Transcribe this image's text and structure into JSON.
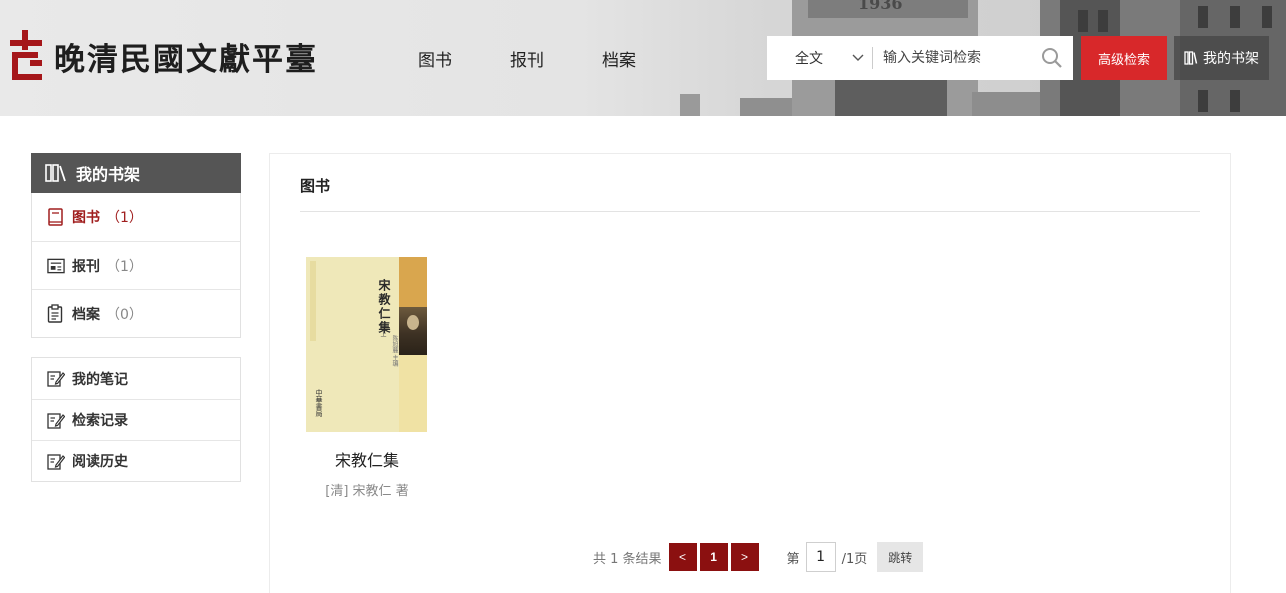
{
  "header": {
    "site_title": "晚清民國文獻平臺",
    "nav": [
      "图书",
      "报刊",
      "档案"
    ],
    "search": {
      "scope": "全文",
      "placeholder": "输入关键词检索"
    },
    "advanced_search": "高级检索",
    "my_shelf": "我的书架",
    "building_sign": "1936"
  },
  "sidebar": {
    "title": "我的书架",
    "categories": [
      {
        "label": "图书",
        "count": "（1）",
        "icon": "book-icon",
        "active": true
      },
      {
        "label": "报刊",
        "count": "（1）",
        "icon": "newspaper-icon",
        "active": false
      },
      {
        "label": "档案",
        "count": "（0）",
        "icon": "clipboard-icon",
        "active": false
      }
    ],
    "tools": [
      {
        "label": "我的笔记",
        "icon": "edit-note-icon"
      },
      {
        "label": "检索记录",
        "icon": "edit-note-icon"
      },
      {
        "label": "阅读历史",
        "icon": "edit-note-icon"
      }
    ]
  },
  "main": {
    "section_title": "图书",
    "books": [
      {
        "title": "宋教仁集",
        "author": "[清] 宋教仁 著",
        "cover_title": "宋教仁集",
        "cover_volume": "上",
        "cover_editor": "陈旭麓 主编",
        "cover_publisher": "中華書局"
      }
    ],
    "pagination": {
      "total_text": "共 1 条结果",
      "prev": "<",
      "current": "1",
      "next": ">",
      "page_prefix": "第",
      "page_input": "1",
      "page_total": "/1页",
      "jump": "跳转"
    }
  },
  "colors": {
    "accent_red": "#d8282a",
    "pager_red": "#8b1010",
    "active_red": "#a01e1e",
    "sidebar_head": "#555555"
  }
}
